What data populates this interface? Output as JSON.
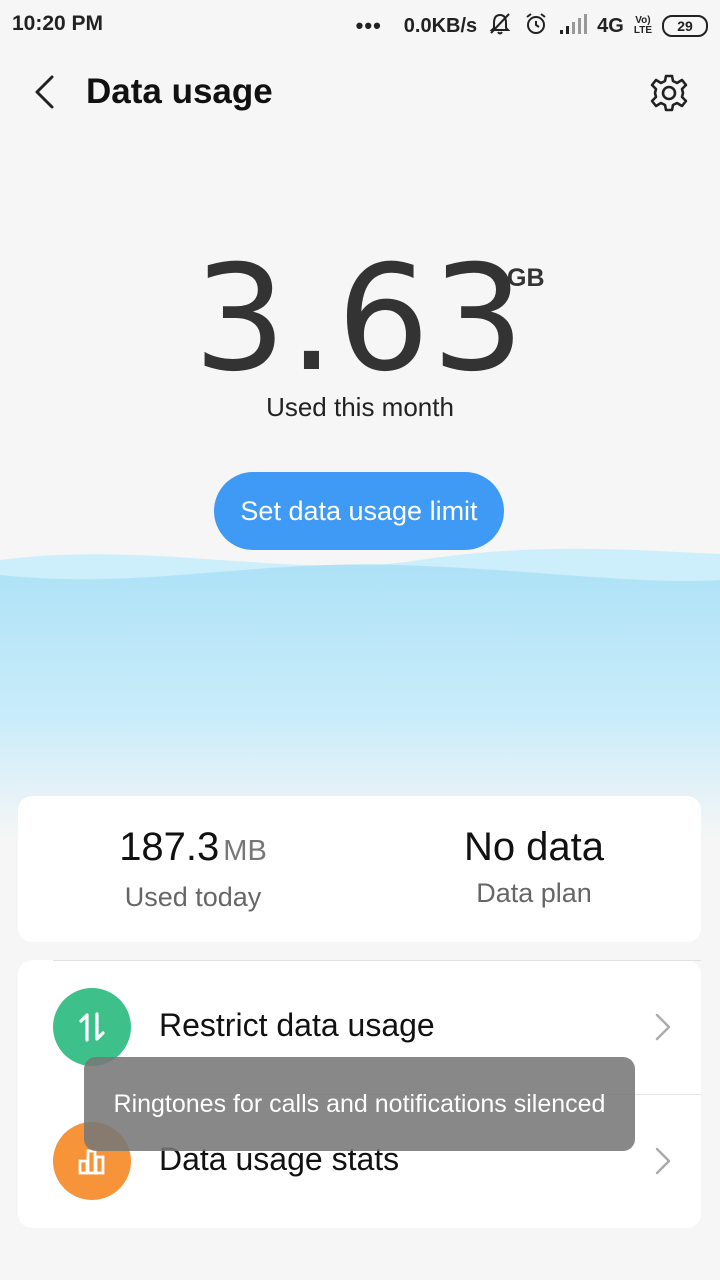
{
  "status_bar": {
    "time": "10:20 PM",
    "dots": "•••",
    "speed": "0.0KB/s",
    "network": "4G",
    "volte_top": "Vo)",
    "volte_bottom": "LTE",
    "battery": "29"
  },
  "header": {
    "title": "Data usage"
  },
  "usage": {
    "value": "3.63",
    "unit": "GB",
    "caption": "Used this month"
  },
  "limit_button": "Set data usage limit",
  "summary": {
    "today_value": "187.3",
    "today_unit": "MB",
    "today_label": "Used today",
    "plan_value": "No data",
    "plan_label": "Data plan"
  },
  "list": {
    "items": [
      {
        "label": "Restrict data usage",
        "icon": "arrows-up-down-icon",
        "color": "#3ec08a"
      },
      {
        "label": "Data usage stats",
        "icon": "bar-chart-icon",
        "color": "#f7943a"
      }
    ]
  },
  "toast": "Ringtones for calls and notifications silenced",
  "colors": {
    "accent": "#3e9af5",
    "wave": "#aee2f7"
  }
}
